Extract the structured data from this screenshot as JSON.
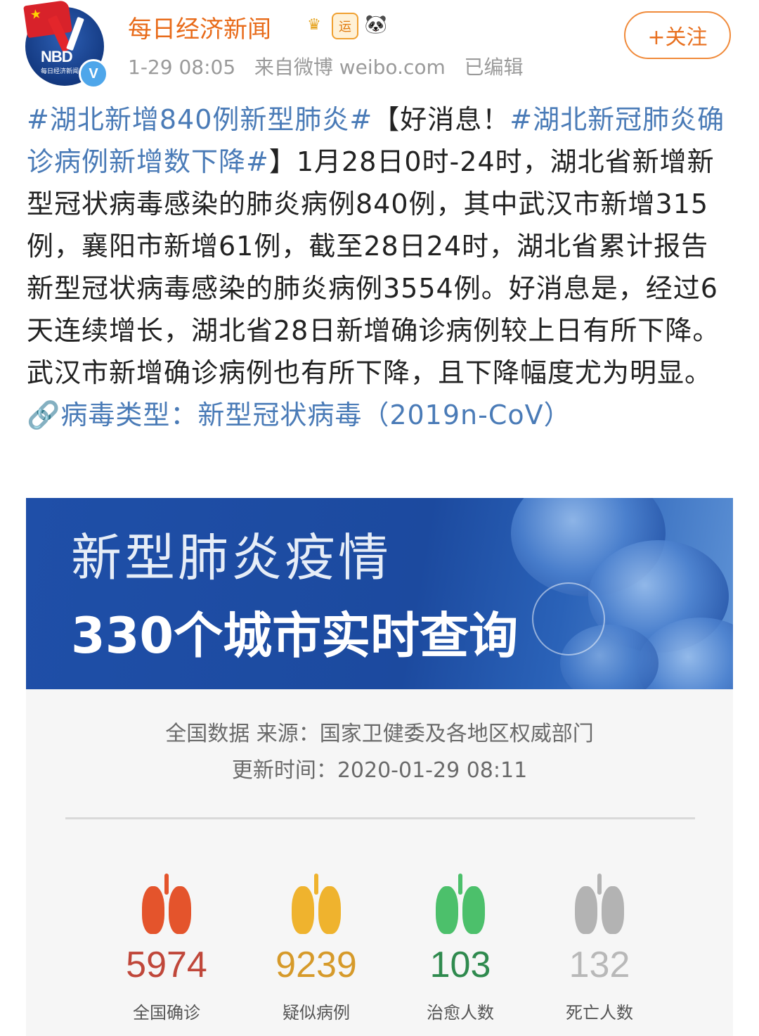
{
  "author": {
    "name": "每日经济新闻",
    "avatar_text": "NBD",
    "avatar_subtext": "每日经济新闻",
    "verified_mark": "V"
  },
  "badges": [
    {
      "icon": "crown-icon",
      "glyph": "♛"
    },
    {
      "icon": "yun-badge-icon",
      "glyph": "运"
    },
    {
      "icon": "panda-icon",
      "glyph": "🐼"
    }
  ],
  "meta": {
    "time": "1-29 08:05",
    "source": "来自微博 weibo.com",
    "edited": "已编辑"
  },
  "follow_button": {
    "label": "+关注"
  },
  "post": {
    "tag1": "#湖北新增840例新型肺炎#",
    "text1": "【好消息！",
    "tag2": "#湖北新冠肺炎确诊病例新增数下降#",
    "text2": "】1月28日0时-24时，湖北省新增新型冠状病毒感染的肺炎病例840例，其中武汉市新增315例，襄阳市新增61例，截至28日24时，湖北省累计报告新型冠状病毒感染的肺炎病例3554例。好消息是，经过6天连续增长，湖北省28日新增确诊病例较上日有所下降。武汉市新增确诊病例也有所下降，且下降幅度尤为明显。",
    "link_icon": "🔗",
    "link_text": "病毒类型：新型冠状病毒（2019n-CoV）"
  },
  "image": {
    "banner_title": "新型肺炎疫情",
    "banner_subtitle": "330个城市实时查询",
    "source_line": "全国数据 来源：国家卫健委及各地区权威部门",
    "updated_line": "更新时间：2020-01-29 08:11",
    "stats": [
      {
        "value": "5974",
        "label": "全国确诊",
        "color": "#c0473a",
        "lung_color": "#e4542c"
      },
      {
        "value": "9239",
        "label": "疑似病例",
        "color": "#d69a2a",
        "lung_color": "#efb32e"
      },
      {
        "value": "103",
        "label": "治愈人数",
        "color": "#2f8a4e",
        "lung_color": "#4cc06b"
      },
      {
        "value": "132",
        "label": "死亡人数",
        "color": "#b8b8b8",
        "lung_color": "#b3b3b3"
      }
    ]
  },
  "colors": {
    "accent_orange": "#e86b1a",
    "link_blue": "#4a7bb7",
    "banner_blue": "#1f4fa8"
  }
}
